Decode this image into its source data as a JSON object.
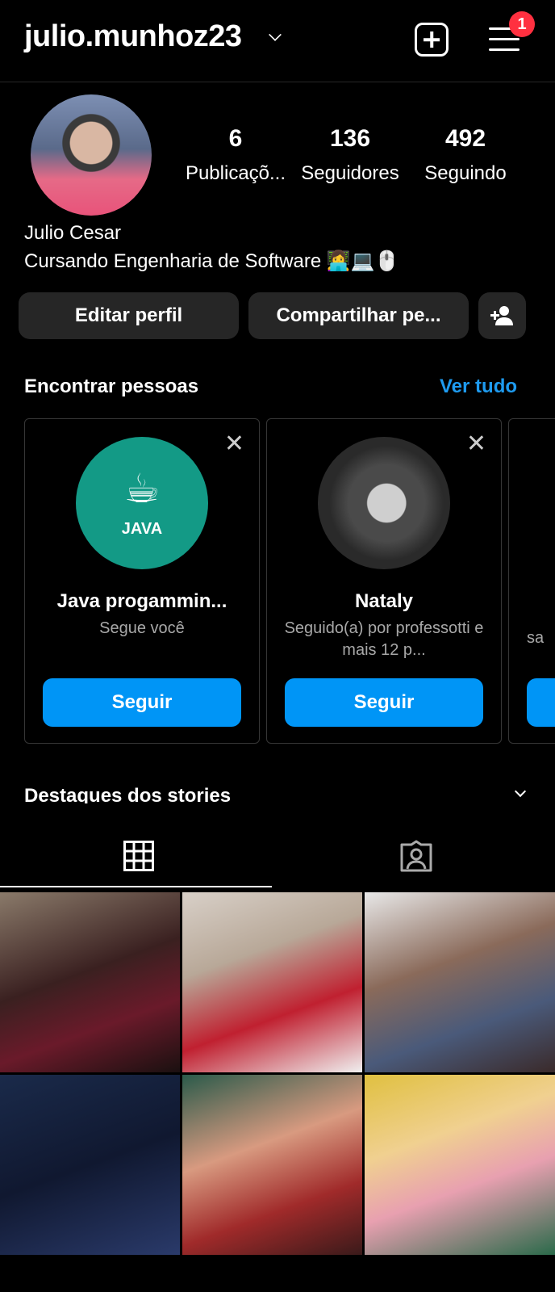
{
  "header": {
    "username": "julio.munhoz23",
    "notification_count": "1"
  },
  "profile": {
    "posts": "6",
    "posts_label": "Publicaçõ...",
    "followers": "136",
    "followers_label": "Seguidores",
    "following": "492",
    "following_label": "Seguindo",
    "name": "Julio Cesar",
    "bio": "Cursando Engenharia de Software 👩‍💻💻🖱️"
  },
  "actions": {
    "edit": "Editar perfil",
    "share": "Compartilhar pe..."
  },
  "suggestions": {
    "title": "Encontrar pessoas",
    "see_all": "Ver tudo",
    "cards": [
      {
        "name": "Java progammin...",
        "subtitle": "Segue você",
        "avatar_text": "JAVA",
        "follow": "Seguir"
      },
      {
        "name": "Nataly",
        "subtitle": "Seguido(a) por professotti e mais 12 p...",
        "follow": "Seguir"
      },
      {
        "subtitle": "sa"
      }
    ]
  },
  "highlights": {
    "title": "Destaques dos stories"
  },
  "tabs": [
    {
      "icon": "grid-icon",
      "active": true
    },
    {
      "icon": "tagged-icon",
      "active": false
    }
  ],
  "colors": {
    "accent": "#0095f6",
    "badge": "#ff3040",
    "button_bg": "#262626"
  }
}
